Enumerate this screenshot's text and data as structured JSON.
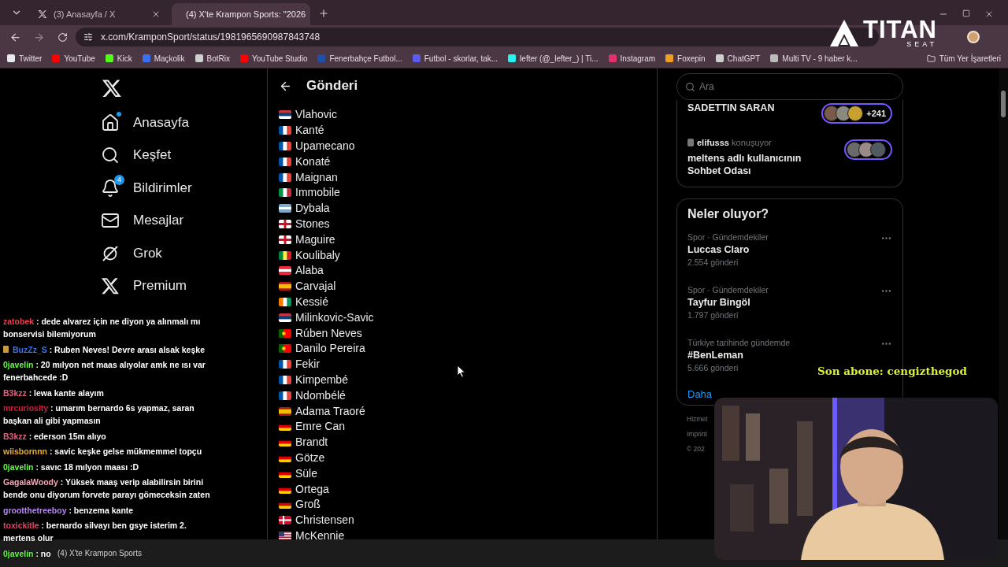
{
  "browser": {
    "tabs": [
      {
        "title": "(3) Anasayfa / X",
        "selected": false
      },
      {
        "title": "(4) X'te Krampon Sports: \"2026",
        "selected": true
      }
    ],
    "url": "x.com/KramponSport/status/1981965690987843748",
    "bookmarks": [
      {
        "label": "Twitter",
        "color": "#e7e9ea"
      },
      {
        "label": "YouTube",
        "color": "#ff0000"
      },
      {
        "label": "Kick",
        "color": "#53fc18"
      },
      {
        "label": "Maçkolik",
        "color": "#3a6ff0"
      },
      {
        "label": "BotRix",
        "color": "#d0d0d0"
      },
      {
        "label": "YouTube Studio",
        "color": "#ff0000"
      },
      {
        "label": "Fenerbahçe Futbol...",
        "color": "#1f4fa8"
      },
      {
        "label": "Futbol - skorlar, tak...",
        "color": "#5b5bf0"
      },
      {
        "label": "lefter (@_lefter_) | Ti...",
        "color": "#25f4ee"
      },
      {
        "label": "Instagram",
        "color": "#e1306c"
      },
      {
        "label": "Foxepin",
        "color": "#f0a020"
      },
      {
        "label": "ChatGPT",
        "color": "#cfcfcf"
      },
      {
        "label": "Multi TV - 9 haber k...",
        "color": "#bbbbbb"
      }
    ],
    "all_bookmarks": "Tüm Yer İşaretleri"
  },
  "logo": {
    "name": "TITAN",
    "sub": "SEAT"
  },
  "nav": [
    {
      "label": "Anasayfa",
      "dot": true
    },
    {
      "label": "Keşfet"
    },
    {
      "label": "Bildirimler",
      "badge": "4"
    },
    {
      "label": "Mesajlar"
    },
    {
      "label": "Grok"
    },
    {
      "label": "Premium"
    }
  ],
  "post": {
    "title": "Gönderi",
    "players": [
      {
        "name": "Vlahovic",
        "kind": "rs"
      },
      {
        "name": "Kanté",
        "kind": "fr"
      },
      {
        "name": "Upamecano",
        "kind": "fr"
      },
      {
        "name": "Konaté",
        "kind": "fr"
      },
      {
        "name": "Maignan",
        "kind": "fr"
      },
      {
        "name": "Immobile",
        "kind": "it"
      },
      {
        "name": "Dybala",
        "kind": "ar"
      },
      {
        "name": "Stones",
        "kind": "en"
      },
      {
        "name": "Maguire",
        "kind": "en"
      },
      {
        "name": "Koulibaly",
        "kind": "sn"
      },
      {
        "name": "Alaba",
        "kind": "at"
      },
      {
        "name": "Carvajal",
        "kind": "es"
      },
      {
        "name": "Kessié",
        "kind": "ci"
      },
      {
        "name": "Milinkovic-Savic",
        "kind": "rs"
      },
      {
        "name": "Rúben Neves",
        "kind": "pt"
      },
      {
        "name": "Danilo Pereira",
        "kind": "pt"
      },
      {
        "name": "Fekir",
        "kind": "fr"
      },
      {
        "name": "Kimpembé",
        "kind": "fr"
      },
      {
        "name": "Ndombélé",
        "kind": "fr"
      },
      {
        "name": "Adama Traoré",
        "kind": "es"
      },
      {
        "name": "Emre Can",
        "kind": "de"
      },
      {
        "name": "Brandt",
        "kind": "de"
      },
      {
        "name": "Götze",
        "kind": "de"
      },
      {
        "name": "Süle",
        "kind": "de"
      },
      {
        "name": "Ortega",
        "kind": "de"
      },
      {
        "name": "Groß",
        "kind": "de"
      },
      {
        "name": "Christensen",
        "kind": "dk"
      },
      {
        "name": "McKennie",
        "kind": "us"
      }
    ]
  },
  "sidebar": {
    "search": {
      "placeholder": "Ara"
    },
    "spaces": [
      {
        "title": "SADETTIN SARAN",
        "count": "+241"
      },
      {
        "host": "elifusss",
        "status": "konuşuyor",
        "title": "meltens adlı kullanıcının Sohbet Odası"
      }
    ],
    "trends_title": "Neler oluyor?",
    "trends": [
      {
        "category": "Spor · Gündemdekiler",
        "title": "Luccas Claro",
        "posts": "2.554 gönderi"
      },
      {
        "category": "Spor · Gündemdekiler",
        "title": "Tayfur Bingöl",
        "posts": "1.797 gönderi"
      },
      {
        "category": "Türkiye tarihinde gündemde",
        "title": "#BenLeman",
        "posts": "5.666 gönderi"
      }
    ],
    "more": "Daha",
    "footer": [
      "Hizmet",
      "Imprint",
      "© 202"
    ]
  },
  "subscriber": "Son abone: cengizthegod",
  "chat": [
    {
      "user": "zatobek",
      "color": "#e8404e",
      "text": ": dede alvarez için ne diyon ya alınmalı mı bonservisi bilemiyorum"
    },
    {
      "user": "BuzZz_S",
      "color": "#3f74e0",
      "badge": true,
      "text": ": Ruben Neves! Devre arası alsak keşke"
    },
    {
      "user": "0javelin",
      "color": "#5cff3a",
      "text": ": 20 mılyon net maas alıyolar amk ne ısı var fenerbahcede :D"
    },
    {
      "user": "B3kzz",
      "color": "#e8607e",
      "text": ": lewa kante alayım"
    },
    {
      "user": "mrcuriosity",
      "color": "#c8203e",
      "text": ": umarım bernardo 6s yapmaz, saran başkan ali gibi yapmasın"
    },
    {
      "user": "B3kzz",
      "color": "#e8607e",
      "text": ": ederson 15m alıyo"
    },
    {
      "user": "wiisbornnn",
      "color": "#e8b030",
      "text": ": savic keşke gelse mükmemmel topçu"
    },
    {
      "user": "0javelin",
      "color": "#5cff3a",
      "text": ": savıc 18 mılyon maası :D"
    },
    {
      "user": "GagalaWoody",
      "color": "#f4a8b8",
      "text": ": Yüksek maaş verip alabilirsin birini bende onu diyorum forvete parayı gömeceksin zaten"
    },
    {
      "user": "grootthetreeboy",
      "color": "#b884f4",
      "text": ": benzema kante"
    },
    {
      "user": "toxickitle",
      "color": "#e8406a",
      "text": ": bernardo silvayı ben gsye isterim 2. mertens olur"
    },
    {
      "user": "0javelin",
      "color": "#5cff3a",
      "text": ": no"
    }
  ],
  "taskbar": {
    "window": "(4) X'te Krampon Sports"
  }
}
